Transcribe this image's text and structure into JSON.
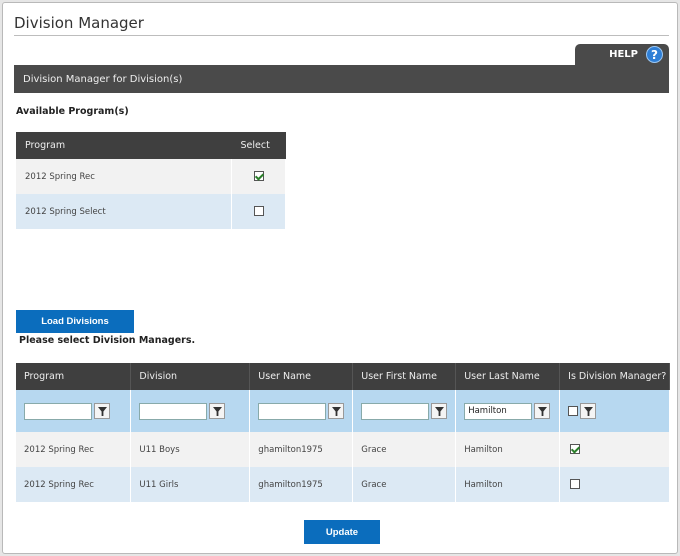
{
  "page": {
    "title": "Division Manager"
  },
  "help": {
    "label": "HELP",
    "icon": "?"
  },
  "section": {
    "title": "Division Manager for Division(s)"
  },
  "available": {
    "label": "Available Program(s)",
    "headers": {
      "program": "Program",
      "select": "Select"
    },
    "rows": [
      {
        "program": "2012 Spring Rec",
        "selected": true
      },
      {
        "program": "2012 Spring Select",
        "selected": false
      }
    ]
  },
  "load_button": "Load Divisions",
  "select_message": "Please select Division Managers.",
  "managers": {
    "headers": {
      "program": "Program",
      "division": "Division",
      "user_name": "User Name",
      "first_name": "User First Name",
      "last_name": "User Last Name",
      "is_manager": "Is Division Manager?"
    },
    "filters": {
      "program": "",
      "division": "",
      "user_name": "",
      "first_name": "",
      "last_name": "Hamilton"
    },
    "rows": [
      {
        "program": "2012 Spring Rec",
        "division": "U11 Boys",
        "user_name": "ghamilton1975",
        "first_name": "Grace",
        "last_name": "Hamilton",
        "is_manager": true
      },
      {
        "program": "2012 Spring Rec",
        "division": "U11 Girls",
        "user_name": "ghamilton1975",
        "first_name": "Grace",
        "last_name": "Hamilton",
        "is_manager": false
      }
    ]
  },
  "update_button": "Update",
  "colors": {
    "accent": "#0b6dbd",
    "header": "#3f3f3f",
    "filter_bg": "#b7d8f0",
    "alt_row": "#dce9f4"
  }
}
